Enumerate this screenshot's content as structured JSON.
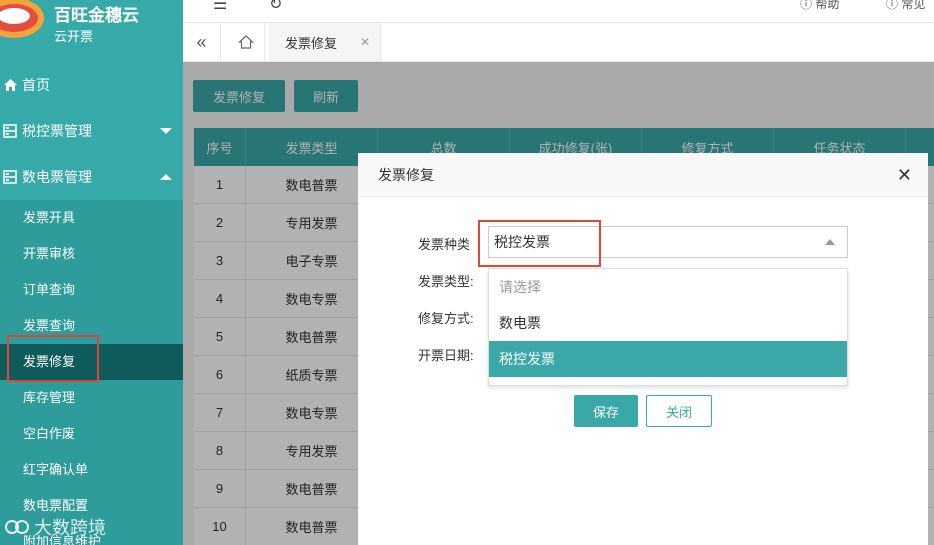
{
  "brand": {
    "title": "百旺金穗云",
    "subtitle": "云开票"
  },
  "sidebar": {
    "home": "首页",
    "tax_control": "税控票管理",
    "digital": "数电票管理",
    "items": [
      "发票开具",
      "开票审核",
      "订单查询",
      "发票查询",
      "发票修复",
      "库存管理",
      "空白作废",
      "红字确认单",
      "数电票配置",
      "附加信息维护"
    ],
    "active_index": 4
  },
  "watermark": "大数跨境",
  "topbar": {
    "help": "帮助",
    "faq": "常见"
  },
  "tabs": {
    "active": "发票修复"
  },
  "toolbar": {
    "repair_button": "发票修复",
    "refresh_button": "刷新"
  },
  "table": {
    "headers": [
      "序号",
      "发票类型",
      "总数",
      "成功修复(张)",
      "修复方式",
      "任务状态"
    ],
    "rows": [
      [
        "1",
        "数电普票"
      ],
      [
        "2",
        "专用发票"
      ],
      [
        "3",
        "电子专票"
      ],
      [
        "4",
        "数电专票"
      ],
      [
        "5",
        "数电普票"
      ],
      [
        "6",
        "纸质专票"
      ],
      [
        "7",
        "数电专票"
      ],
      [
        "8",
        "专用发票"
      ],
      [
        "9",
        "数电普票"
      ],
      [
        "10",
        "数电普票"
      ]
    ]
  },
  "modal": {
    "title": "发票修复",
    "labels": {
      "kind": "发票种类",
      "type": "发票类型:",
      "method": "修复方式:",
      "date": "开票日期:"
    },
    "select_value": "税控发票",
    "options": [
      "请选择",
      "数电票",
      "税控发票"
    ],
    "selected_option": "税控发票",
    "save": "保存",
    "close": "关闭"
  },
  "colors": {
    "accent": "#3aa8a8",
    "sidebar": "#36aaa9",
    "active_nav": "#0f5a5a",
    "highlight": "#e0453a"
  }
}
